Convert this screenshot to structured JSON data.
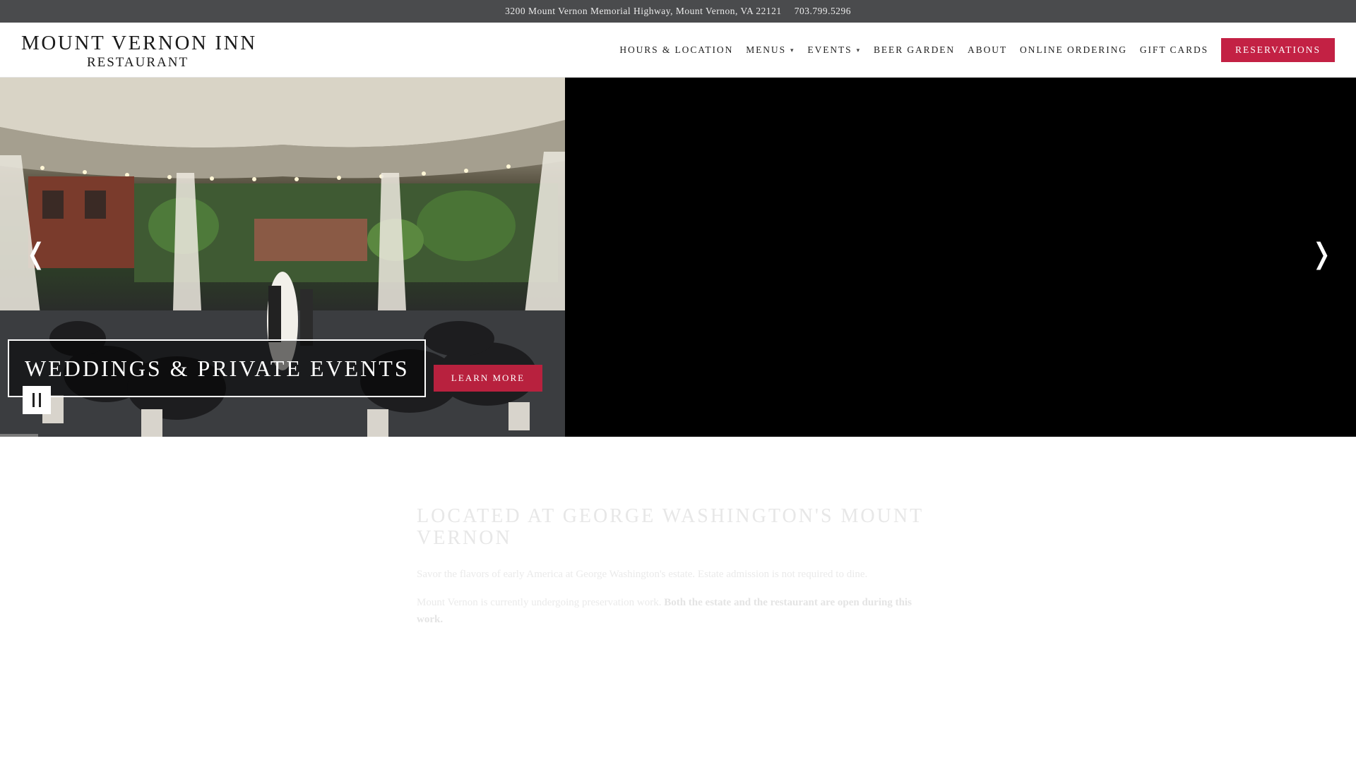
{
  "topbar": {
    "address": "3200 Mount Vernon Memorial Highway, Mount Vernon, VA 22121",
    "phone": "703.799.5296"
  },
  "logo": {
    "line1": "MOUNT VERNON INN",
    "line2": "RESTAURANT"
  },
  "nav": {
    "items": [
      {
        "label": "HOURS & LOCATION"
      },
      {
        "label": "MENUS",
        "has_dropdown": true
      },
      {
        "label": "EVENTS",
        "has_dropdown": true
      },
      {
        "label": "BEER GARDEN"
      },
      {
        "label": "ABOUT"
      },
      {
        "label": "ONLINE ORDERING"
      },
      {
        "label": "GIFT CARDS"
      }
    ],
    "cta": "RESERVATIONS",
    "dropdown_icon": "chevron-down-icon"
  },
  "hero": {
    "caption": "WEDDINGS & PRIVATE EVENTS",
    "button": "LEARN MORE",
    "prev_icon": "chevron-left-icon",
    "next_icon": "chevron-right-icon",
    "pause_icon": "pause-icon",
    "image": "wedding ceremony under tent"
  },
  "intro": {
    "heading": "LOCATED AT GEORGE WASHINGTON'S MOUNT VERNON",
    "p1": "Savor the flavors of early America at George Washington's estate. Estate admission is not required to dine.",
    "p2_plain": "Mount Vernon is currently undergoing preservation work. ",
    "p2_bold": "Both the estate and the restaurant are open during this work."
  },
  "colors": {
    "topbar_bg": "#4a4b4d",
    "accent": "#c32144",
    "hero_bg": "#000000"
  }
}
